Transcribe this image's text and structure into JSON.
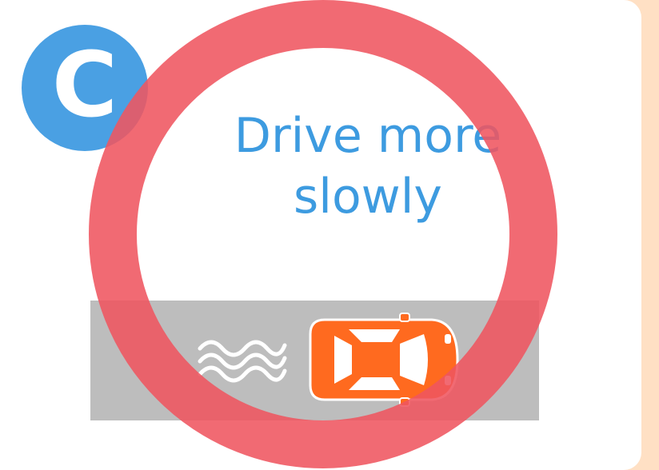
{
  "badge": {
    "letter": "C",
    "color": "#4aa0e3"
  },
  "message": {
    "text": "Drive more slowly",
    "line1": "Drive more",
    "line2": "slowly",
    "color": "#3d9be0"
  },
  "illustration": {
    "icons": [
      "water-waves-icon",
      "car-icon"
    ],
    "car_color": "#ff6a1f",
    "road_color": "#bdbdbd"
  },
  "overlay": {
    "symbol": "circle",
    "color": "#ef5560"
  },
  "palette": {
    "background": "#ffe0c4",
    "card": "#ffffff"
  }
}
